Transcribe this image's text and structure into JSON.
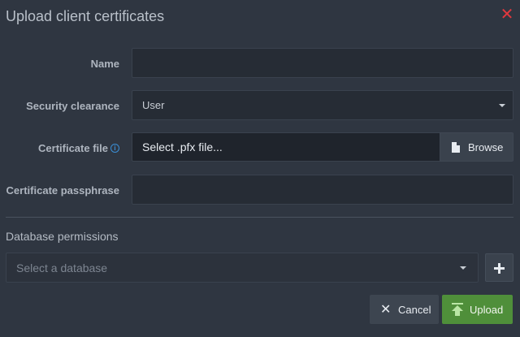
{
  "dialog": {
    "title": "Upload client certificates",
    "close_icon": "close-x-icon"
  },
  "form": {
    "name_label": "Name",
    "name_value": "",
    "clearance_label": "Security clearance",
    "clearance_value": "User",
    "certificate_label": "Certificate file",
    "certificate_placeholder": "Select .pfx file...",
    "browse_label": "Browse",
    "passphrase_label": "Certificate passphrase",
    "passphrase_value": ""
  },
  "permissions": {
    "title": "Database permissions",
    "db_placeholder": "Select a database"
  },
  "actions": {
    "cancel_label": "Cancel",
    "upload_label": "Upload"
  },
  "colors": {
    "background": "#2f3641",
    "close": "#e0383e",
    "upload": "#4f8f3a",
    "info": "#3b8fd6"
  }
}
